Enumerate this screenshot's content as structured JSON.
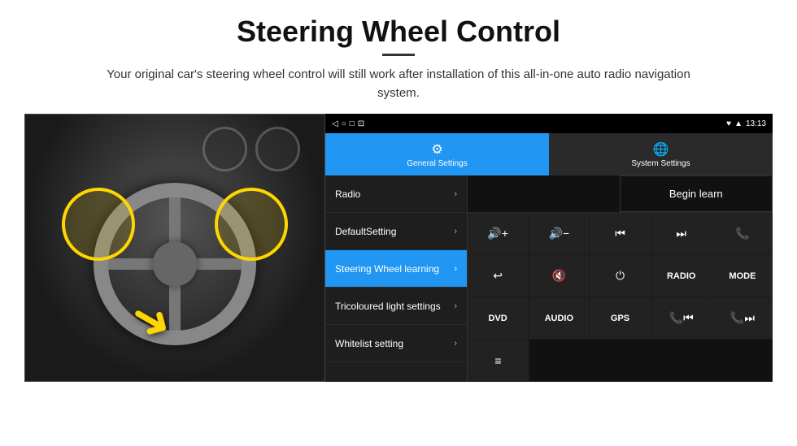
{
  "header": {
    "title": "Steering Wheel Control",
    "divider": true,
    "subtitle": "Your original car's steering wheel control will still work after installation of this all-in-one auto radio navigation system."
  },
  "status_bar": {
    "time": "13:13",
    "icons": [
      "◂",
      "○",
      "□",
      "⊡",
      "♥",
      "▲"
    ]
  },
  "tabs": [
    {
      "id": "general",
      "label": "General Settings",
      "icon": "⚙",
      "active": true
    },
    {
      "id": "system",
      "label": "System Settings",
      "icon": "🌐",
      "active": false
    }
  ],
  "menu_items": [
    {
      "label": "Radio",
      "active": false
    },
    {
      "label": "DefaultSetting",
      "active": false
    },
    {
      "label": "Steering Wheel learning",
      "active": true
    },
    {
      "label": "Tricoloured light settings",
      "active": false
    },
    {
      "label": "Whitelist setting",
      "active": false
    }
  ],
  "control_panel": {
    "begin_learn_label": "Begin learn",
    "rows": [
      [
        {
          "type": "icon",
          "icon": "🔊+",
          "label": "vol-up"
        },
        {
          "type": "icon",
          "icon": "🔊-",
          "label": "vol-down"
        },
        {
          "type": "icon",
          "icon": "⏮",
          "label": "prev"
        },
        {
          "type": "icon",
          "icon": "⏭",
          "label": "next"
        },
        {
          "type": "icon",
          "icon": "📞",
          "label": "phone"
        }
      ],
      [
        {
          "type": "icon",
          "icon": "↩",
          "label": "hang-up"
        },
        {
          "type": "text",
          "text": "🔊×",
          "label": "mute"
        },
        {
          "type": "icon",
          "icon": "⏻",
          "label": "power"
        },
        {
          "type": "text",
          "text": "RADIO",
          "label": "radio"
        },
        {
          "type": "text",
          "text": "MODE",
          "label": "mode"
        }
      ],
      [
        {
          "type": "text",
          "text": "DVD",
          "label": "dvd"
        },
        {
          "type": "text",
          "text": "AUDIO",
          "label": "audio"
        },
        {
          "type": "text",
          "text": "GPS",
          "label": "gps"
        },
        {
          "type": "icon",
          "icon": "📞⏮",
          "label": "call-prev"
        },
        {
          "type": "icon",
          "icon": "📞⏭",
          "label": "call-next"
        }
      ],
      [
        {
          "type": "icon",
          "icon": "≡",
          "label": "menu"
        }
      ]
    ]
  }
}
